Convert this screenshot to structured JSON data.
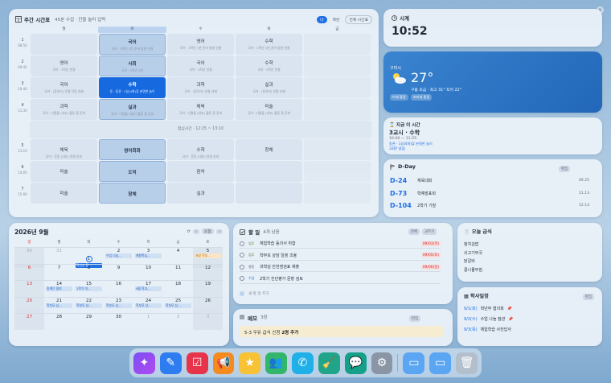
{
  "timetable": {
    "title": "주간 시간표",
    "subtitle": "45분 수업 · 칸을 눌러 입력",
    "view_me": "나",
    "view_class": "학반",
    "view_all": "전체 시간표",
    "days": [
      "월",
      "화",
      "수",
      "목",
      "금"
    ],
    "periods": [
      {
        "num": "1",
        "time": "08:50"
      },
      {
        "num": "2",
        "time": "09:45"
      },
      {
        "num": "3",
        "time": "10:40"
      },
      {
        "num": "4",
        "time": "11:35"
      },
      {
        "num": "5",
        "time": "13:10"
      },
      {
        "num": "6",
        "time": "14:05"
      },
      {
        "num": "7",
        "time": "15:00"
      }
    ],
    "lunch": "점심시간 · 12:25 ~ 13:10",
    "rows": [
      [
        {
          "s": "",
          "m": ""
        },
        {
          "s": "국어",
          "m": "국어 · 3학년 1반 준비 방향 연결"
        },
        {
          "s": "영어",
          "m": "국어 · 3학년 1반 준비 방향 연결"
        },
        {
          "s": "수학",
          "m": "국어 · 3학년 1반 준비 방향 연결"
        },
        {
          "s": "",
          "m": ""
        }
      ],
      [
        {
          "s": "영어",
          "m": "국어 · 3학년 연결"
        },
        {
          "s": "사회",
          "m": "국어 · 3학년 1반"
        },
        {
          "s": "국어",
          "m": "국어 · 3학년 연결"
        },
        {
          "s": "수학",
          "m": "국어 · 3학년 연결"
        },
        {
          "s": "",
          "m": ""
        }
      ],
      [
        {
          "s": "국어",
          "m": "국어 · (동아리) 연결 작업 과제"
        },
        {
          "s": "수학",
          "m": "동 · 동관 · 1능0(화)류 분명한 놀이"
        },
        {
          "s": "과학",
          "m": "국어 · (동아리) 연결 과제"
        },
        {
          "s": "실과",
          "m": "국어 · (동아리) 연결 과제"
        },
        {
          "s": "",
          "m": ""
        }
      ],
      [
        {
          "s": "과학",
          "m": "국어 · 디편물 (내부) 활동 중 준비"
        },
        {
          "s": "실과",
          "m": "국어 · 디편물 (내부) 활동 중 준비"
        },
        {
          "s": "체육",
          "m": "국어 · 디편물 (내부) 활동 중 준비"
        },
        {
          "s": "미술",
          "m": "국어 · 디편물 (내부) 활동 중 준비"
        },
        {
          "s": "",
          "m": ""
        }
      ],
      [
        {
          "s": "체육",
          "m": "국어 · 운동 (내부) 연결 준비"
        },
        {
          "s": "영어회화",
          "m": ""
        },
        {
          "s": "수학",
          "m": "국어 · 운동 (내부) 연결 준비"
        },
        {
          "s": "창체",
          "m": ""
        },
        {
          "s": "",
          "m": ""
        }
      ],
      [
        {
          "s": "미술",
          "m": ""
        },
        {
          "s": "도덕",
          "m": ""
        },
        {
          "s": "음악",
          "m": ""
        },
        {
          "s": "",
          "m": ""
        },
        {
          "s": "",
          "m": ""
        }
      ],
      [
        {
          "s": "미술",
          "m": ""
        },
        {
          "s": "창체",
          "m": ""
        },
        {
          "s": "실과",
          "m": ""
        },
        {
          "s": "",
          "m": ""
        },
        {
          "s": "",
          "m": ""
        }
      ]
    ]
  },
  "clock": {
    "label": "시계",
    "time": "10:52"
  },
  "weather": {
    "location": "구미시",
    "temp": "27°",
    "detail": "구름 조금 · 최고 31° 최저 22°",
    "chip1": "미세 좋음",
    "chip2": "초미세 좋음"
  },
  "now_class": {
    "label": "지금 이 시간",
    "subject": "3교시 · 수학",
    "time": "10:40 — 11:25",
    "memo": "동관 · 1능0(화)류 분명한 놀이",
    "remaining": "33분 남음"
  },
  "dday": {
    "title": "D-Day",
    "edit": "편집",
    "items": [
      {
        "d": "D-24",
        "t": "체육대회",
        "date": "09.25"
      },
      {
        "d": "D-73",
        "t": "학예발표회",
        "date": "11.13"
      },
      {
        "d": "D-104",
        "t": "2학기 기말",
        "date": "12.14"
      }
    ]
  },
  "calendar": {
    "title": "2026년 9월",
    "today_btn": "오늘",
    "dow": [
      "일",
      "월",
      "화",
      "수",
      "목",
      "금",
      "토"
    ],
    "weeks": [
      [
        {
          "n": "30",
          "dim": true
        },
        {
          "n": "31",
          "dim": true
        },
        {
          "n": "1",
          "today": true,
          "ev": "학년부 협...",
          "evc": "dark"
        },
        {
          "n": "2",
          "ev": "수업 나눔...",
          "evc": ""
        },
        {
          "n": "3",
          "ev": "체험학습...",
          "evc": ""
        },
        {
          "n": "4",
          "ev": "",
          "evc": ""
        },
        {
          "n": "5",
          "ev": "표창 학부...",
          "evc": "orange"
        }
      ],
      [
        {
          "n": "6",
          "sun": true
        },
        {
          "n": "7",
          "ev": "",
          "evc": ""
        },
        {
          "n": "8",
          "ev": "",
          "evc": ""
        },
        {
          "n": "9",
          "ev": "",
          "evc": ""
        },
        {
          "n": "10",
          "ev": "",
          "evc": ""
        },
        {
          "n": "11",
          "ev": "",
          "evc": ""
        },
        {
          "n": "12",
          "ev": "",
          "evc": ""
        }
      ],
      [
        {
          "n": "13",
          "sun": true
        },
        {
          "n": "14",
          "ev": "동계단 협의",
          "evc": ""
        },
        {
          "n": "15",
          "ev": "2학기 지...",
          "evc": ""
        },
        {
          "n": "16",
          "ev": "",
          "evc": ""
        },
        {
          "n": "17",
          "ev": "9월 학교...",
          "evc": ""
        },
        {
          "n": "18",
          "ev": "",
          "evc": ""
        },
        {
          "n": "19",
          "ev": "",
          "evc": ""
        }
      ],
      [
        {
          "n": "20",
          "sun": true
        },
        {
          "n": "21",
          "ev": "학부모 상...",
          "evc": ""
        },
        {
          "n": "22",
          "ev": "학부모 상...",
          "evc": ""
        },
        {
          "n": "23",
          "ev": "학부모 상...",
          "evc": ""
        },
        {
          "n": "24",
          "ev": "학부모 상...",
          "evc": ""
        },
        {
          "n": "25",
          "ev": "학부모 상...",
          "evc": ""
        },
        {
          "n": "26",
          "ev": "",
          "evc": ""
        }
      ],
      [
        {
          "n": "27",
          "sun": true
        },
        {
          "n": "28",
          "ev": "",
          "evc": ""
        },
        {
          "n": "29",
          "ev": "",
          "evc": ""
        },
        {
          "n": "30",
          "ev": "",
          "evc": ""
        },
        {
          "n": "1",
          "dim": true
        },
        {
          "n": "2",
          "dim": true
        },
        {
          "n": "3",
          "dim": true
        }
      ]
    ]
  },
  "todo": {
    "title": "할 일",
    "count": "4개 남음",
    "tab_all": "전체",
    "tab_done": "교무기",
    "items": [
      {
        "cat": "업무",
        "catc": "",
        "text": "체험학습 동의서 취합",
        "due": "09/03(목)"
      },
      {
        "cat": "업무",
        "catc": "",
        "text": "학부모 상담 일정 조율",
        "due": "09/05(토)"
      },
      {
        "cat": "행정",
        "catc": "gray",
        "text": "과학실 안전점검표 제출",
        "due": "09/06(일)"
      },
      {
        "cat": "수업",
        "catc": "blue",
        "text": "2학기 진단평가 문항 검토",
        "due": ""
      }
    ],
    "add_placeholder": "새 할 일 추가"
  },
  "memo": {
    "title": "메모",
    "count": "3장",
    "edit": "편집",
    "note_prefix": "5-3 우유 급식 신청 ",
    "note_bold": "2명 추가"
  },
  "lunch": {
    "title": "오늘 급식",
    "items": [
      "참치김밥",
      "쇠고기무국",
      "닭갈비",
      "콩나물무침"
    ]
  },
  "schedule": {
    "title": "학사일정",
    "edit": "편집",
    "items": [
      {
        "d": "9/1(화)",
        "t": "학년부 협의회"
      },
      {
        "d": "9/2(수)",
        "t": "수업 나눔 참관"
      },
      {
        "d": "9/3(목)",
        "t": "체험학습 사전답사"
      }
    ]
  },
  "dock": {
    "apps": [
      "ai-assistant",
      "pen-notes",
      "checklist",
      "announcement",
      "favorites",
      "contacts",
      "phone",
      "cleanup",
      "messages",
      "settings",
      "folder-1",
      "folder-2",
      "trash"
    ]
  },
  "colors": {
    "accent": "#1f6fe5",
    "weather_bg": "#2a73c4",
    "warn": "#c33"
  }
}
